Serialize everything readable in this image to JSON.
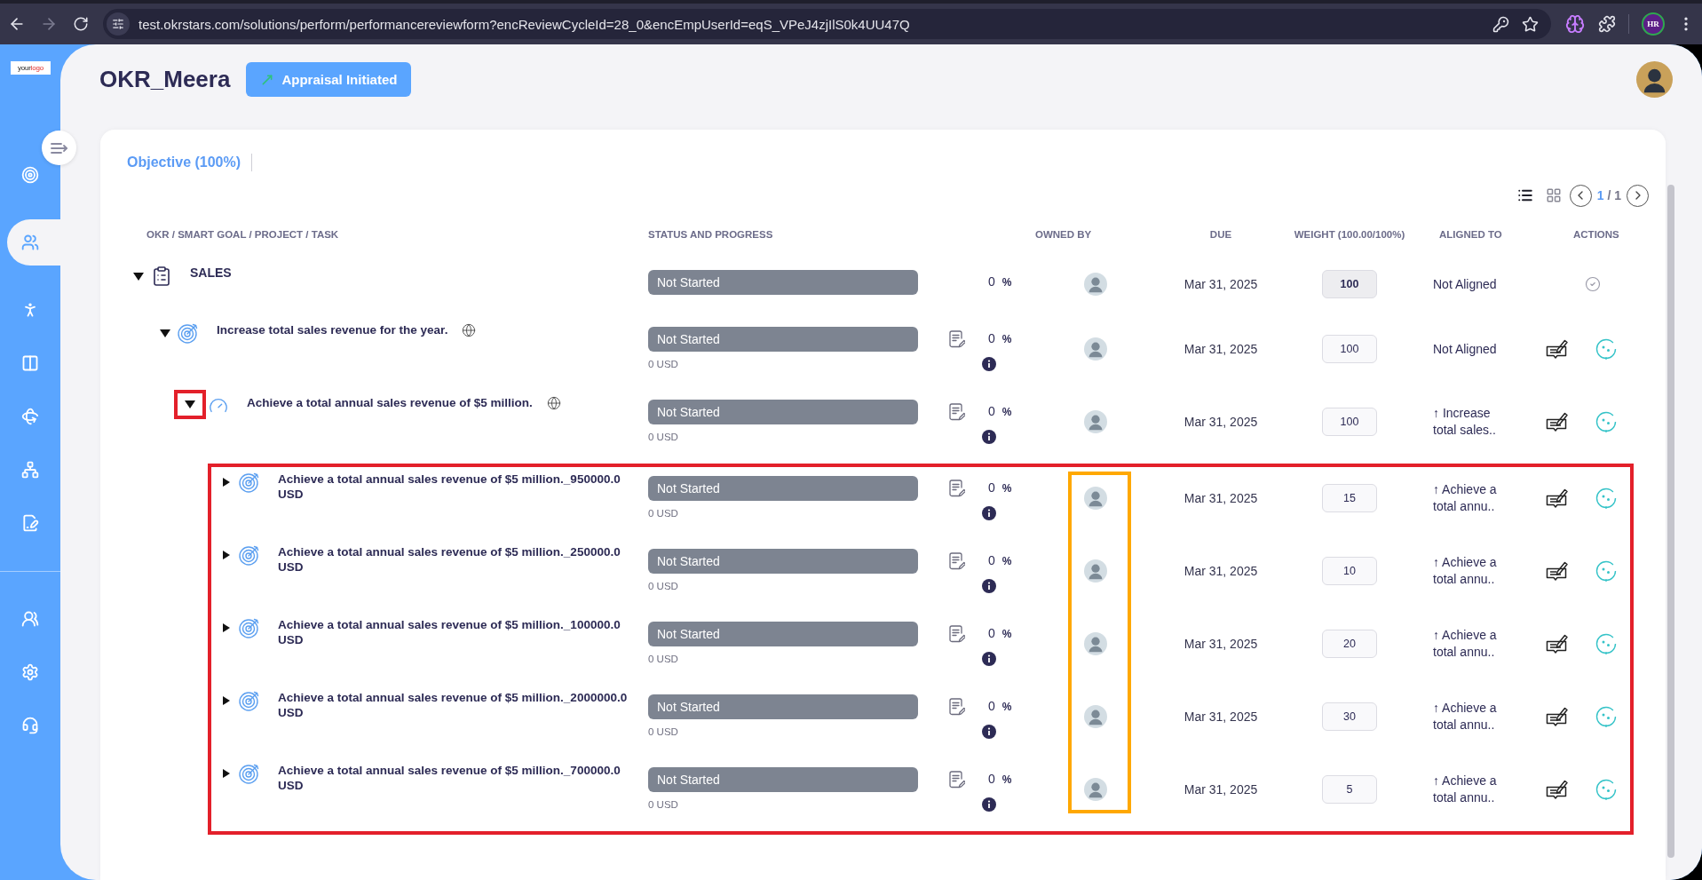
{
  "browser": {
    "url": "test.okrstars.com/solutions/perform/performancereviewform?encReviewCycleId=28_0&encEmpUserId=eqS_VPeJ4zjIlS0k4UU47Q",
    "profile": "HR"
  },
  "logo": {
    "first": "your",
    "second": "logo"
  },
  "sidebar": {
    "items": [
      {
        "kind": "goals",
        "selected": false
      },
      {
        "kind": "team",
        "selected": true
      },
      {
        "kind": "person",
        "selected": false
      },
      {
        "kind": "cards",
        "selected": false
      },
      {
        "kind": "review360",
        "selected": false
      },
      {
        "kind": "hierarchy",
        "selected": false
      },
      {
        "kind": "document",
        "selected": false
      }
    ],
    "bottom_items": [
      {
        "kind": "groups",
        "selected": false
      },
      {
        "kind": "settings",
        "selected": false
      },
      {
        "kind": "support",
        "selected": false
      }
    ]
  },
  "header": {
    "title": "OKR_Meera",
    "status_button": "Appraisal Initiated"
  },
  "section": {
    "title": "Objective (100%)"
  },
  "view_toggles": [
    {
      "kind": "list",
      "selected": true
    },
    {
      "kind": "grid",
      "selected": false
    }
  ],
  "pagination": {
    "current": "1",
    "separator": "/",
    "total": "1"
  },
  "table": {
    "columns": [
      "OKR / SMART GOAL / PROJECT / TASK",
      "STATUS AND PROGRESS",
      "OWNED BY",
      "DUE",
      "WEIGHT (100.00/100%)",
      "ALIGNED TO",
      "ACTIONS"
    ],
    "rows": [
      {
        "kind": "category",
        "name": "SALES",
        "shared": false,
        "expanded": true,
        "status": "Not Started",
        "progress": "0",
        "unit": "%",
        "due": "Mar 31, 2025",
        "weight": "100",
        "weight_editable": false,
        "aligned_to": "Not Aligned",
        "children": [
          {
            "kind": "objective",
            "name": "Increase total sales revenue for the year.",
            "shared": true,
            "expanded": true,
            "status": "Not Started",
            "amount": "0 USD",
            "progress": "0",
            "unit": "%",
            "due": "Mar 31, 2025",
            "weight": "100",
            "weight_editable": true,
            "aligned_to": "Not Aligned",
            "children": [
              {
                "kind": "key_result",
                "name": "Achieve a total annual sales revenue of $5 million.",
                "shared": true,
                "expanded": true,
                "toggle_boxed": true,
                "children_boxed": true,
                "owners_boxed": true,
                "status": "Not Started",
                "amount": "0 USD",
                "progress": "0",
                "unit": "%",
                "due": "Mar 31, 2025",
                "weight": "100",
                "weight_editable": true,
                "aligned_to": "↑ Increase total sales..",
                "children": [
                  {
                    "kind": "objective",
                    "name": "Achieve a total annual sales revenue of $5 million._950000.0 USD",
                    "shared": false,
                    "expanded": false,
                    "status": "Not Started",
                    "amount": "0 USD",
                    "progress": "0",
                    "unit": "%",
                    "due": "Mar 31, 2025",
                    "weight": "15",
                    "weight_editable": true,
                    "aligned_to": "↑ Achieve a total annu.."
                  },
                  {
                    "kind": "objective",
                    "name": "Achieve a total annual sales revenue of $5 million._250000.0 USD",
                    "shared": false,
                    "expanded": false,
                    "status": "Not Started",
                    "amount": "0 USD",
                    "progress": "0",
                    "unit": "%",
                    "due": "Mar 31, 2025",
                    "weight": "10",
                    "weight_editable": true,
                    "aligned_to": "↑ Achieve a total annu.."
                  },
                  {
                    "kind": "objective",
                    "name": "Achieve a total annual sales revenue of $5 million._100000.0 USD",
                    "shared": false,
                    "expanded": false,
                    "status": "Not Started",
                    "amount": "0 USD",
                    "progress": "0",
                    "unit": "%",
                    "due": "Mar 31, 2025",
                    "weight": "20",
                    "weight_editable": true,
                    "aligned_to": "↑ Achieve a total annu.."
                  },
                  {
                    "kind": "objective",
                    "name": "Achieve a total annual sales revenue of $5 million._2000000.0 USD",
                    "shared": false,
                    "expanded": false,
                    "status": "Not Started",
                    "amount": "0 USD",
                    "progress": "0",
                    "unit": "%",
                    "due": "Mar 31, 2025",
                    "weight": "30",
                    "weight_editable": true,
                    "aligned_to": "↑ Achieve a total annu.."
                  },
                  {
                    "kind": "objective",
                    "name": "Achieve a total annual sales revenue of $5 million._700000.0 USD",
                    "shared": false,
                    "expanded": false,
                    "status": "Not Started",
                    "amount": "0 USD",
                    "progress": "0",
                    "unit": "%",
                    "due": "Mar 31, 2025",
                    "weight": "5",
                    "weight_editable": true,
                    "aligned_to": "↑ Achieve a total annu.."
                  }
                ]
              }
            ]
          }
        ]
      }
    ]
  }
}
